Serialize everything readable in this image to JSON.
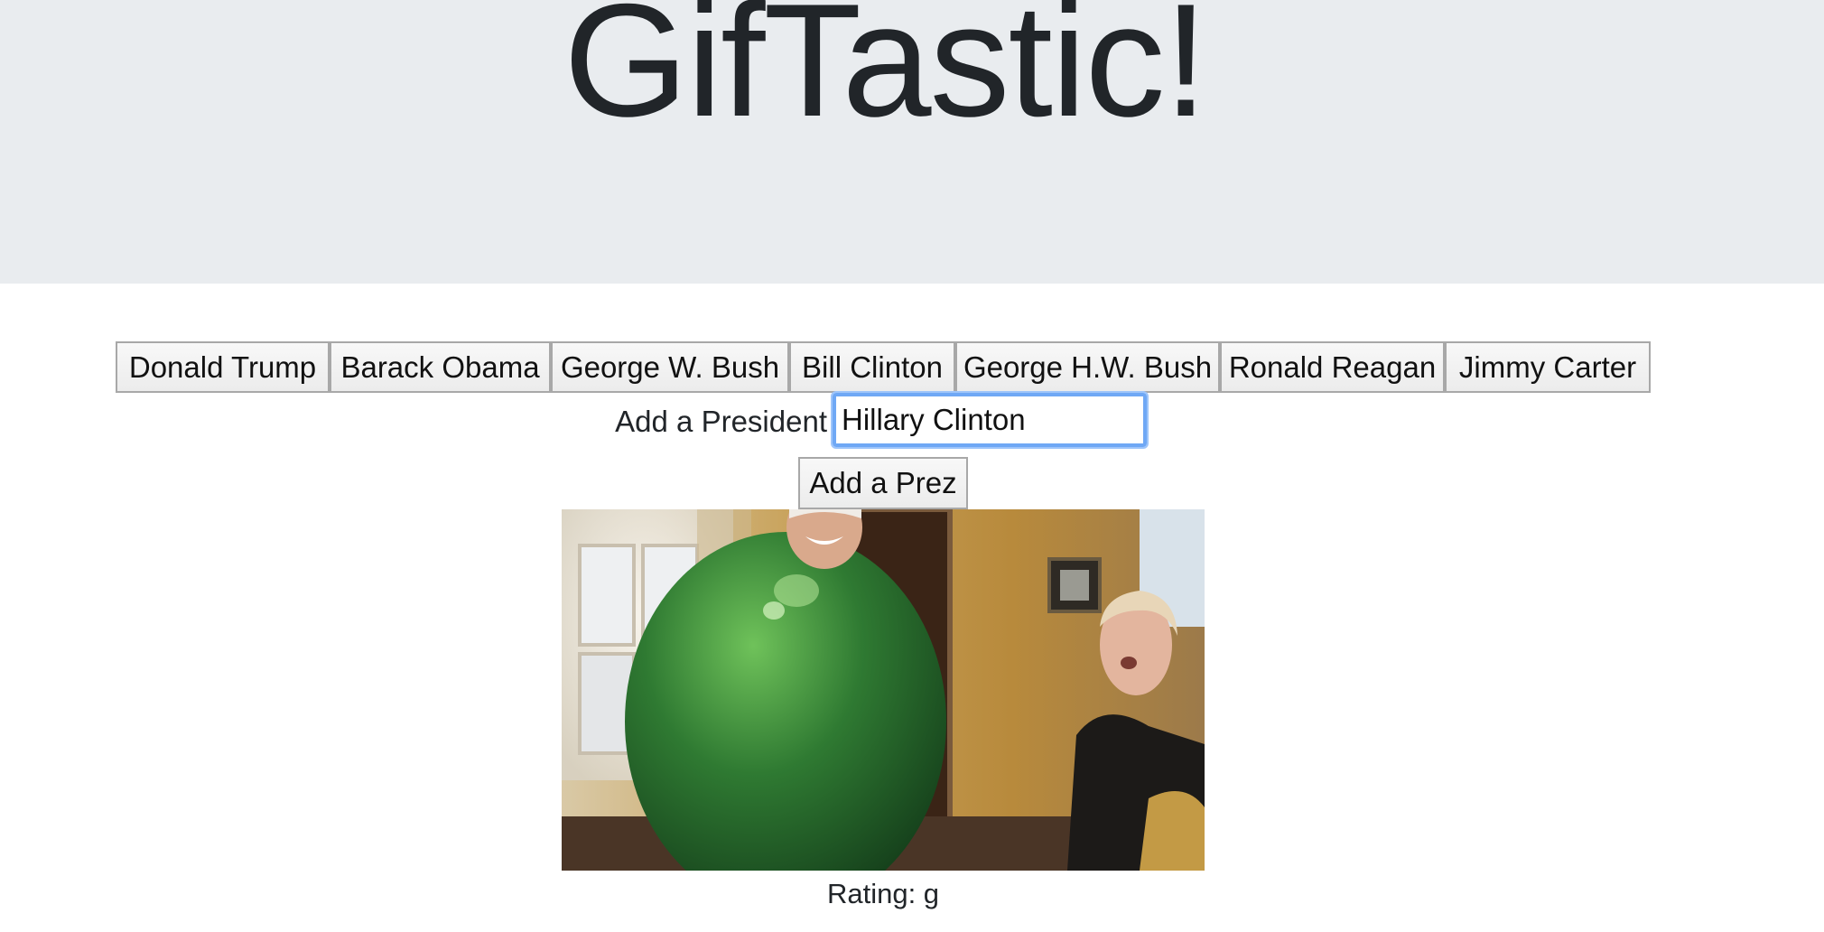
{
  "header": {
    "title": "GifTastic!",
    "background": "#e9ecef"
  },
  "president_buttons": [
    "Donald Trump",
    "Barack Obama",
    "George W. Bush",
    "Bill Clinton",
    "George H.W. Bush",
    "Ronald Reagan",
    "Jimmy Carter"
  ],
  "form": {
    "label": "Add a President",
    "input_value": "Hillary Clinton",
    "submit_label": "Add a Prez"
  },
  "gif": {
    "rating_text": "Rating: g"
  },
  "colors": {
    "focus_ring": "#6fa8f5",
    "button_border": "#a8a8a8"
  }
}
